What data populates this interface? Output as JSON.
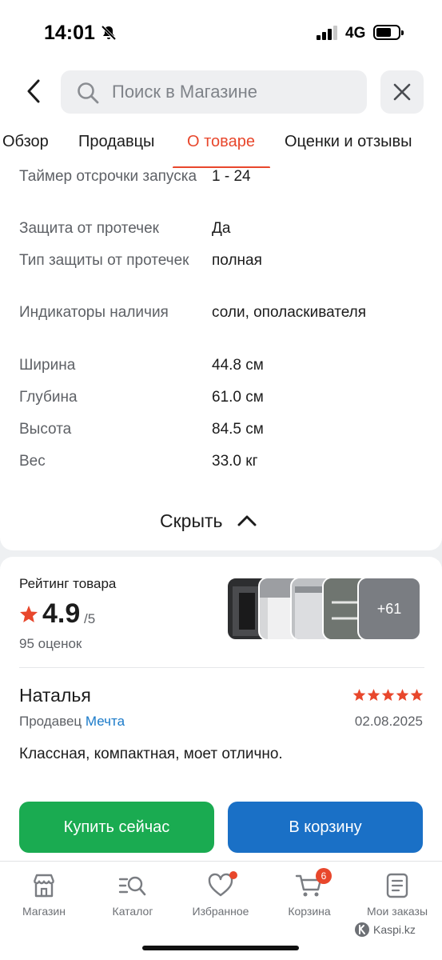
{
  "status_bar": {
    "time": "14:01",
    "network": "4G"
  },
  "search": {
    "placeholder": "Поиск в Магазине"
  },
  "tabs": [
    {
      "label": "Обзор",
      "active": false
    },
    {
      "label": "Продавцы",
      "active": false
    },
    {
      "label": "О товаре",
      "active": true
    },
    {
      "label": "Оценки и отзывы",
      "active": false
    }
  ],
  "specs": [
    {
      "name": "Таймер отсрочки запуска",
      "value": "1 - 24"
    },
    {
      "name": "Защита от протечек",
      "value": "Да"
    },
    {
      "name": "Тип защиты от протечек",
      "value": "полная"
    },
    {
      "name": "Индикаторы наличия",
      "value": "соли, ополаскивателя"
    },
    {
      "name": "Ширина",
      "value": "44.8 см"
    },
    {
      "name": "Глубина",
      "value": "61.0 см"
    },
    {
      "name": "Высота",
      "value": "84.5 см"
    },
    {
      "name": "Вес",
      "value": "33.0 кг"
    }
  ],
  "hide_label": "Скрыть",
  "rating": {
    "title": "Рейтинг товара",
    "value": "4.9",
    "max": "/5",
    "count": "95 оценок",
    "more_photos": "+61"
  },
  "review": {
    "author": "Наталья",
    "stars": 5,
    "seller_label": "Продавец",
    "seller_name": "Мечта",
    "date": "02.08.2025",
    "text": "Классная, компактная, моет отлично."
  },
  "actions": {
    "buy_now": "Купить сейчас",
    "to_cart": "В корзину"
  },
  "bottom_nav": {
    "shop": "Магазин",
    "catalog": "Каталог",
    "favorites": "Избранное",
    "cart": "Корзина",
    "cart_count": "6",
    "orders": "Мои заказы"
  },
  "watermark": "Kaspi.kz",
  "colors": {
    "accent_red": "#e8472c",
    "buy_green": "#1aab51",
    "cart_blue": "#1a70c6",
    "link_blue": "#1a7ac9"
  }
}
